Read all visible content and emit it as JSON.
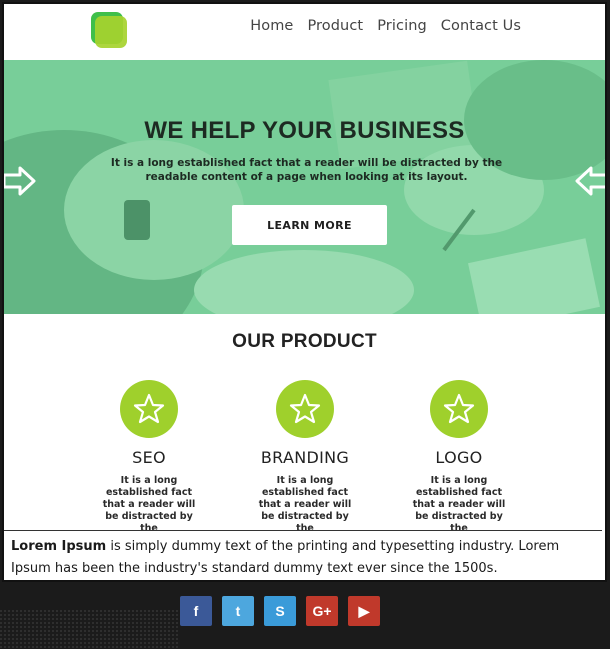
{
  "nav": {
    "items": [
      "Home",
      "Product",
      "Pricing",
      "Contact Us"
    ]
  },
  "hero": {
    "title": "WE HELP YOUR BUSINESS",
    "subtitle": "It is a long established fact that a reader will be distracted by the readable content of a page when looking at its layout.",
    "button_label": "LEARN MORE"
  },
  "products": {
    "title": "OUR PRODUCT",
    "items": [
      {
        "name": "SEO",
        "desc": "It is a long established fact that a reader will be distracted by the"
      },
      {
        "name": "BRANDING",
        "desc": "It is a long established fact that a reader will be distracted by the"
      },
      {
        "name": "LOGO",
        "desc": "It is a long established fact that a reader will be distracted by the"
      }
    ]
  },
  "lorem": {
    "bold": "Lorem Ipsum",
    "text": " is simply dummy text of the printing and typesetting industry. Lorem Ipsum has been the industry's standard dummy text ever since the 1500s."
  },
  "social": [
    {
      "icon": "facebook-icon",
      "glyph": "f",
      "color": "#3b5998"
    },
    {
      "icon": "twitter-icon",
      "glyph": "t",
      "color": "#4da7de"
    },
    {
      "icon": "skype-icon",
      "glyph": "S",
      "color": "#3a9bd9"
    },
    {
      "icon": "google-plus-icon",
      "glyph": "G+",
      "color": "#c0392b"
    },
    {
      "icon": "youtube-icon",
      "glyph": "▶",
      "color": "#c0392b"
    }
  ],
  "colors": {
    "accent": "#9fd02c",
    "hero_tint": "#66cd8c",
    "footer_bg": "#1b1b1b"
  }
}
